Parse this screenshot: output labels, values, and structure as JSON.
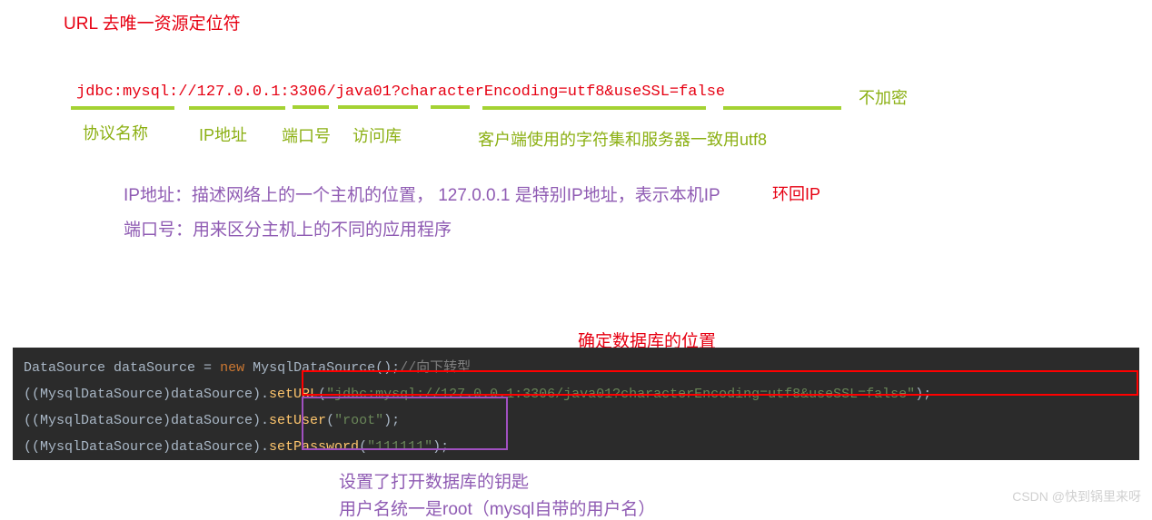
{
  "title": "URL  去唯一资源定位符",
  "url_string": "jdbc:mysql://127.0.0.1:3306/java01?characterEncoding=utf8&useSSL=false",
  "url_parts": {
    "protocol": "协议名称",
    "ip": "IP地址",
    "port": "端口号",
    "db": "访问库",
    "charset": "客户端使用的字符集和服务器一致用utf8",
    "ssl": "不加密"
  },
  "explanations": {
    "ip_desc": "IP地址：描述网络上的一个主机的位置， 127.0.0.1 是特别IP地址，表示本机IP",
    "loop_ip": "环回IP",
    "port_desc": "端口号：用来区分主机上的不同的应用程序"
  },
  "annotation_db_location": "确定数据库的位置",
  "annotation_key1": "设置了打开数据库的钥匙",
  "annotation_key2": "用户名统一是root（mysql自带的用户名）",
  "code": {
    "line1": {
      "type1": "DataSource ",
      "var": "dataSource = ",
      "kw_new": "new ",
      "type2": "MysqlDataSource",
      "paren": "();",
      "comment": "//向下转型"
    },
    "line2": {
      "cast": "((MysqlDataSource)dataSource).",
      "fn": "setURL",
      "open": "(",
      "str": "\"jdbc:mysql://127.0.0.1:3306/java01?characterEncoding=utf8&useSSL=false\"",
      "close": ");"
    },
    "line3": {
      "cast": "((MysqlDataSource)dataSource).",
      "fn": "setUser",
      "open": "(",
      "str": "\"root\"",
      "close": ");"
    },
    "line4": {
      "cast": "((MysqlDataSource)dataSource).",
      "fn": "setPassword",
      "open": "(",
      "str": "\"111111\"",
      "close": ");"
    }
  },
  "watermark": "CSDN @快到锅里来呀"
}
